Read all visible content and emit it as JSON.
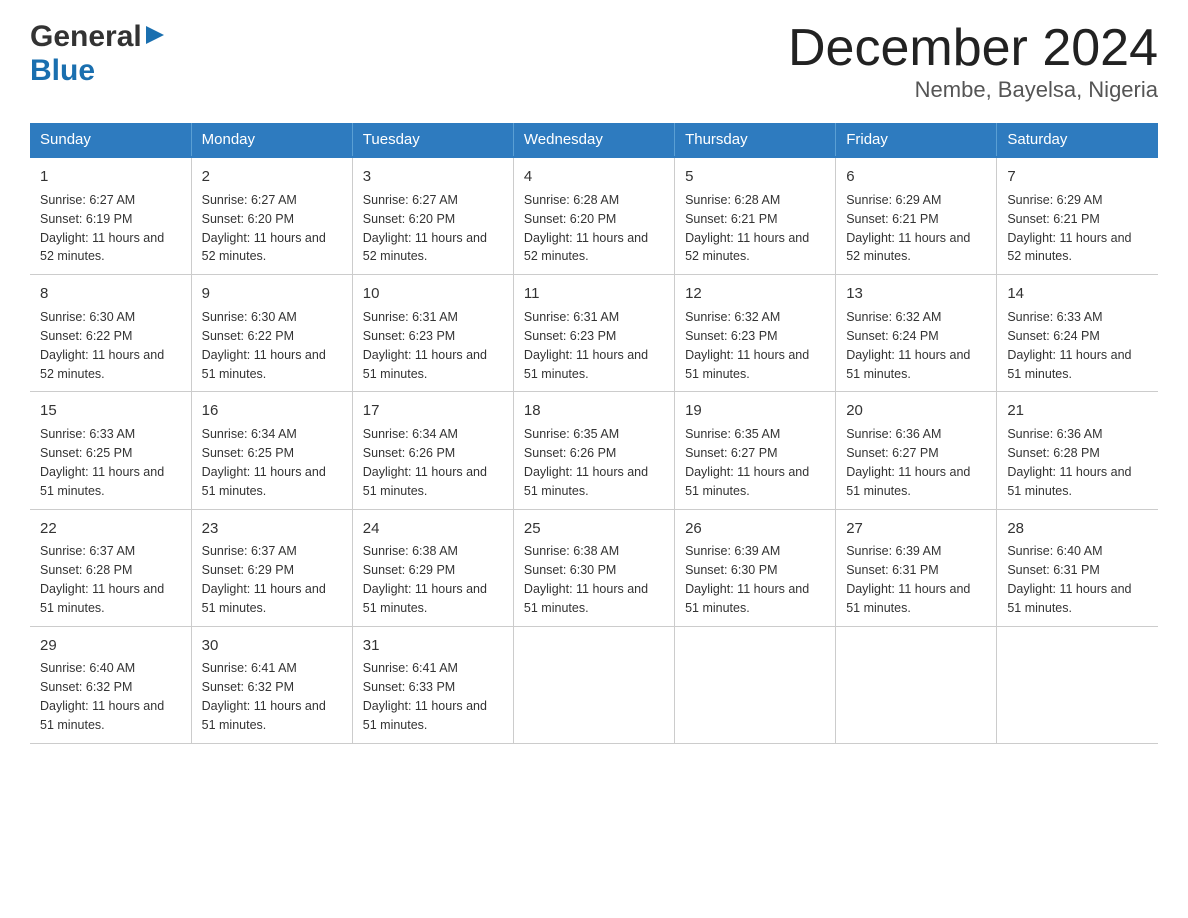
{
  "header": {
    "logo_general": "General",
    "logo_blue": "Blue",
    "title": "December 2024",
    "subtitle": "Nembe, Bayelsa, Nigeria"
  },
  "days_of_week": [
    "Sunday",
    "Monday",
    "Tuesday",
    "Wednesday",
    "Thursday",
    "Friday",
    "Saturday"
  ],
  "weeks": [
    [
      {
        "num": "1",
        "sunrise": "6:27 AM",
        "sunset": "6:19 PM",
        "daylight": "11 hours and 52 minutes."
      },
      {
        "num": "2",
        "sunrise": "6:27 AM",
        "sunset": "6:20 PM",
        "daylight": "11 hours and 52 minutes."
      },
      {
        "num": "3",
        "sunrise": "6:27 AM",
        "sunset": "6:20 PM",
        "daylight": "11 hours and 52 minutes."
      },
      {
        "num": "4",
        "sunrise": "6:28 AM",
        "sunset": "6:20 PM",
        "daylight": "11 hours and 52 minutes."
      },
      {
        "num": "5",
        "sunrise": "6:28 AM",
        "sunset": "6:21 PM",
        "daylight": "11 hours and 52 minutes."
      },
      {
        "num": "6",
        "sunrise": "6:29 AM",
        "sunset": "6:21 PM",
        "daylight": "11 hours and 52 minutes."
      },
      {
        "num": "7",
        "sunrise": "6:29 AM",
        "sunset": "6:21 PM",
        "daylight": "11 hours and 52 minutes."
      }
    ],
    [
      {
        "num": "8",
        "sunrise": "6:30 AM",
        "sunset": "6:22 PM",
        "daylight": "11 hours and 52 minutes."
      },
      {
        "num": "9",
        "sunrise": "6:30 AM",
        "sunset": "6:22 PM",
        "daylight": "11 hours and 51 minutes."
      },
      {
        "num": "10",
        "sunrise": "6:31 AM",
        "sunset": "6:23 PM",
        "daylight": "11 hours and 51 minutes."
      },
      {
        "num": "11",
        "sunrise": "6:31 AM",
        "sunset": "6:23 PM",
        "daylight": "11 hours and 51 minutes."
      },
      {
        "num": "12",
        "sunrise": "6:32 AM",
        "sunset": "6:23 PM",
        "daylight": "11 hours and 51 minutes."
      },
      {
        "num": "13",
        "sunrise": "6:32 AM",
        "sunset": "6:24 PM",
        "daylight": "11 hours and 51 minutes."
      },
      {
        "num": "14",
        "sunrise": "6:33 AM",
        "sunset": "6:24 PM",
        "daylight": "11 hours and 51 minutes."
      }
    ],
    [
      {
        "num": "15",
        "sunrise": "6:33 AM",
        "sunset": "6:25 PM",
        "daylight": "11 hours and 51 minutes."
      },
      {
        "num": "16",
        "sunrise": "6:34 AM",
        "sunset": "6:25 PM",
        "daylight": "11 hours and 51 minutes."
      },
      {
        "num": "17",
        "sunrise": "6:34 AM",
        "sunset": "6:26 PM",
        "daylight": "11 hours and 51 minutes."
      },
      {
        "num": "18",
        "sunrise": "6:35 AM",
        "sunset": "6:26 PM",
        "daylight": "11 hours and 51 minutes."
      },
      {
        "num": "19",
        "sunrise": "6:35 AM",
        "sunset": "6:27 PM",
        "daylight": "11 hours and 51 minutes."
      },
      {
        "num": "20",
        "sunrise": "6:36 AM",
        "sunset": "6:27 PM",
        "daylight": "11 hours and 51 minutes."
      },
      {
        "num": "21",
        "sunrise": "6:36 AM",
        "sunset": "6:28 PM",
        "daylight": "11 hours and 51 minutes."
      }
    ],
    [
      {
        "num": "22",
        "sunrise": "6:37 AM",
        "sunset": "6:28 PM",
        "daylight": "11 hours and 51 minutes."
      },
      {
        "num": "23",
        "sunrise": "6:37 AM",
        "sunset": "6:29 PM",
        "daylight": "11 hours and 51 minutes."
      },
      {
        "num": "24",
        "sunrise": "6:38 AM",
        "sunset": "6:29 PM",
        "daylight": "11 hours and 51 minutes."
      },
      {
        "num": "25",
        "sunrise": "6:38 AM",
        "sunset": "6:30 PM",
        "daylight": "11 hours and 51 minutes."
      },
      {
        "num": "26",
        "sunrise": "6:39 AM",
        "sunset": "6:30 PM",
        "daylight": "11 hours and 51 minutes."
      },
      {
        "num": "27",
        "sunrise": "6:39 AM",
        "sunset": "6:31 PM",
        "daylight": "11 hours and 51 minutes."
      },
      {
        "num": "28",
        "sunrise": "6:40 AM",
        "sunset": "6:31 PM",
        "daylight": "11 hours and 51 minutes."
      }
    ],
    [
      {
        "num": "29",
        "sunrise": "6:40 AM",
        "sunset": "6:32 PM",
        "daylight": "11 hours and 51 minutes."
      },
      {
        "num": "30",
        "sunrise": "6:41 AM",
        "sunset": "6:32 PM",
        "daylight": "11 hours and 51 minutes."
      },
      {
        "num": "31",
        "sunrise": "6:41 AM",
        "sunset": "6:33 PM",
        "daylight": "11 hours and 51 minutes."
      },
      null,
      null,
      null,
      null
    ]
  ],
  "labels": {
    "sunrise": "Sunrise:",
    "sunset": "Sunset:",
    "daylight": "Daylight:"
  }
}
